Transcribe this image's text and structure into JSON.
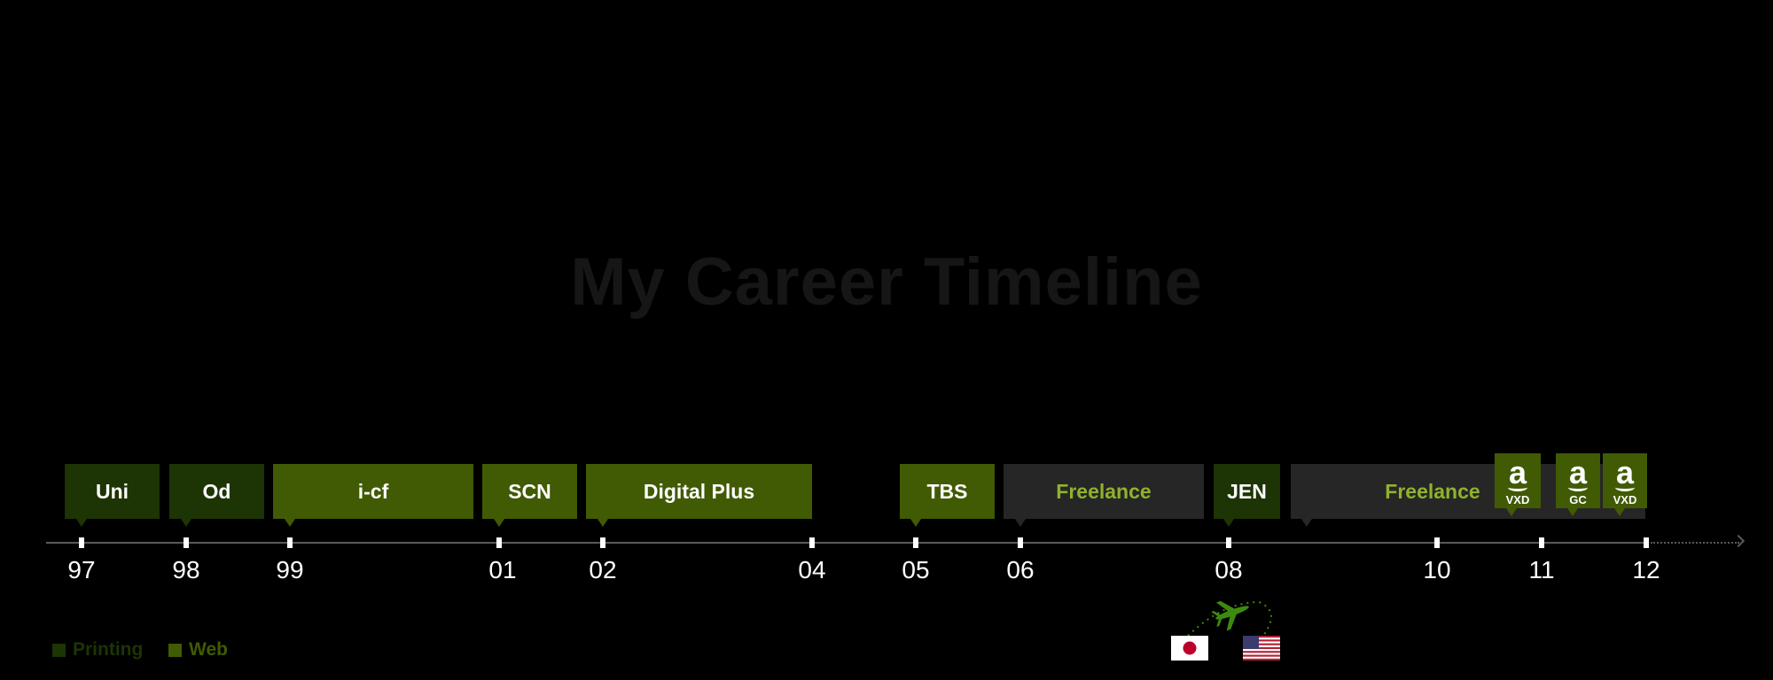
{
  "title": "My Career Timeline",
  "colors": {
    "printing": "#1d3405",
    "web": "#415a04",
    "freelance_bg": "#262626",
    "freelance_text": "#8fb22c",
    "tick": "#ffffff",
    "axis": "#5a5a5a"
  },
  "years": [
    "97",
    "98",
    "99",
    "01",
    "02",
    "04",
    "05",
    "06",
    "08",
    "10",
    "11",
    "12"
  ],
  "jobs": [
    {
      "label": "Uni",
      "category": "printing"
    },
    {
      "label": "Od",
      "category": "printing"
    },
    {
      "label": "i-cf",
      "category": "web"
    },
    {
      "label": "SCN",
      "category": "web"
    },
    {
      "label": "Digital Plus",
      "category": "web"
    },
    {
      "label": "TBS",
      "category": "web"
    },
    {
      "label": "Freelance",
      "category": "freelance"
    },
    {
      "label": "JEN",
      "category": "printing"
    },
    {
      "label": "Freelance",
      "category": "freelance"
    }
  ],
  "amazon": [
    {
      "glyph": "a",
      "label": "VXD",
      "icon": "amazon-logo-icon"
    },
    {
      "glyph": "a",
      "label": "GC",
      "icon": "amazon-logo-icon"
    },
    {
      "glyph": "a",
      "label": "VXD",
      "icon": "amazon-logo-icon"
    }
  ],
  "legend": [
    {
      "label": "Printing",
      "color": "#1d3405"
    },
    {
      "label": "Web",
      "color": "#415a04"
    }
  ],
  "relocation": {
    "from_icon": "japan-flag-icon",
    "to_icon": "usa-flag-icon",
    "via_icon": "airplane-icon"
  }
}
